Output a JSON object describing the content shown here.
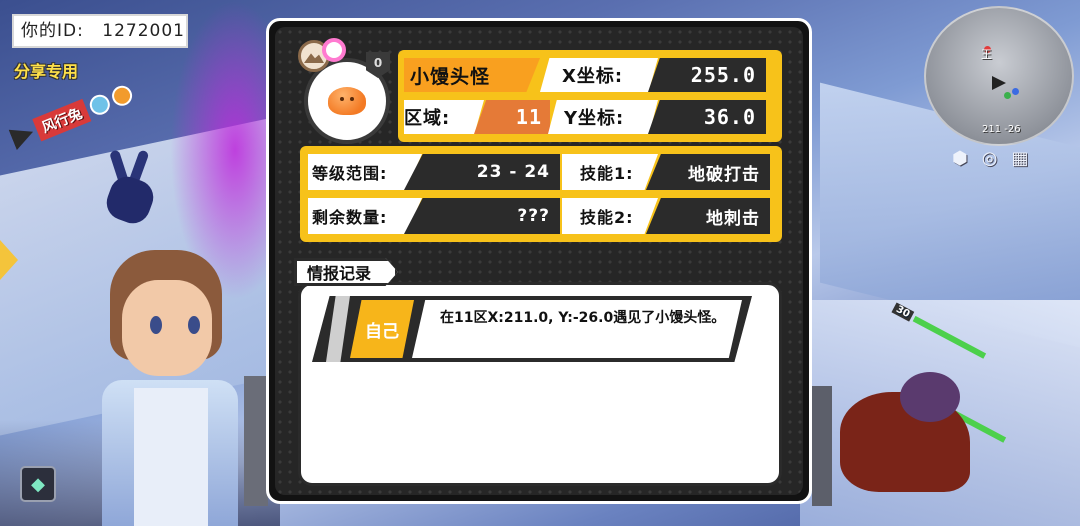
{
  "player": {
    "id_label": "你的ID:",
    "id_value": "1272001",
    "share_label": "分享专用"
  },
  "npc_tag": {
    "name": "风行兔",
    "icons": [
      "bunny-ear-icon",
      "paw-icon"
    ]
  },
  "minimap": {
    "place_name": "王",
    "coords": "211 -26",
    "icons": [
      "location-pin-icon",
      "target-icon",
      "map-icon"
    ]
  },
  "monster_info": {
    "avatar_level": "0",
    "name": "小馒头怪",
    "x_label": "X坐标:",
    "x_value": "255.0",
    "zone_label": "区域:",
    "zone_value": "11",
    "y_label": "Y坐标:",
    "y_value": "36.0",
    "level_range_label": "等级范围:",
    "level_range_value": "23 - 24",
    "remaining_label": "剩余数量:",
    "remaining_value": "???",
    "skill1_label": "技能1:",
    "skill1_value": "地破打击",
    "skill2_label": "技能2:",
    "skill2_value": "地刺击"
  },
  "intel": {
    "section_title": "情报记录",
    "records": [
      {
        "source": "自己",
        "text": "在11区X:211.0, Y:-26.0遇见了小馒头怪。"
      }
    ]
  },
  "colors": {
    "panel_bg": "#262626",
    "accent_yellow": "#f7c21a",
    "accent_orange": "#e57a37",
    "name_orange": "#f9a01f"
  }
}
